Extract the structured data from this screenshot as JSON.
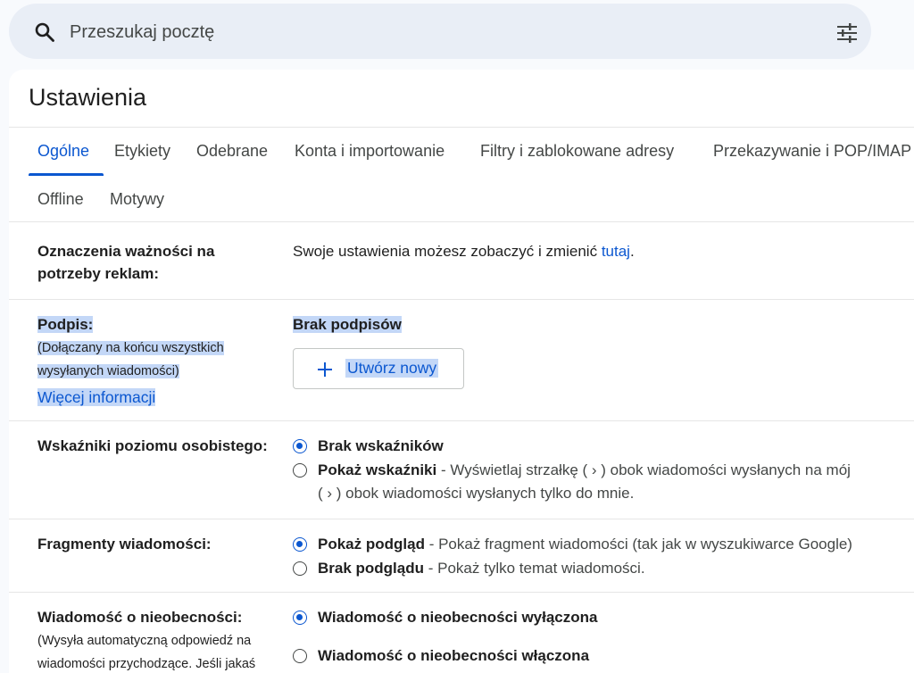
{
  "search": {
    "placeholder": "Przeszukaj pocztę"
  },
  "page": {
    "title": "Ustawienia"
  },
  "tabs": {
    "row1": [
      "Ogólne",
      "Etykiety",
      "Odebrane",
      "Konta i importowanie",
      "Filtry i zablokowane adresy",
      "Przekazywanie i POP/IMAP"
    ],
    "row2": [
      "Offline",
      "Motywy"
    ],
    "active": "Ogólne"
  },
  "settings": {
    "ads": {
      "label_line1": "Oznaczenia ważności na",
      "label_line2": "potrzeby reklam:",
      "text_before": "Swoje ustawienia możesz zobaczyć i zmienić ",
      "link": "tutaj",
      "text_after": "."
    },
    "signature": {
      "label": "Podpis:",
      "desc_line1": "(Dołączany na końcu wszystkich",
      "desc_line2": "wysyłanych wiadomości)",
      "more_info": "Więcej informacji",
      "none": "Brak podpisów",
      "create_button": "Utwórz nowy"
    },
    "personal_level": {
      "label": "Wskaźniki poziomu osobistego:",
      "options": [
        {
          "title": "Brak wskaźników",
          "desc": "",
          "checked": true
        },
        {
          "title": "Pokaż wskaźniki",
          "desc": " - Wyświetlaj strzałkę ( › ) obok wiadomości wysłanych na mój",
          "checked": false
        }
      ],
      "desc_line2": "( › ) obok wiadomości wysłanych tylko do mnie."
    },
    "snippets": {
      "label": "Fragmenty wiadomości:",
      "options": [
        {
          "title": "Pokaż podgląd",
          "desc": " - Pokaż fragment wiadomości (tak jak w wyszukiwarce Google)",
          "checked": true
        },
        {
          "title": "Brak podglądu",
          "desc": " - Pokaż tylko temat wiadomości.",
          "checked": false
        }
      ]
    },
    "vacation": {
      "label": "Wiadomość o nieobecności:",
      "desc_line1": "(Wysyła automatyczną odpowiedź na",
      "desc_line2": "wiadomości przychodzące. Jeśli jakaś",
      "options": [
        {
          "title": "Wiadomość o nieobecności wyłączona",
          "checked": true
        },
        {
          "title": "Wiadomość o nieobecności włączona",
          "checked": false
        }
      ]
    }
  },
  "colors": {
    "accent": "#0b57d0",
    "highlight": "#c3d7f7",
    "search_bg": "#e9eef6"
  }
}
